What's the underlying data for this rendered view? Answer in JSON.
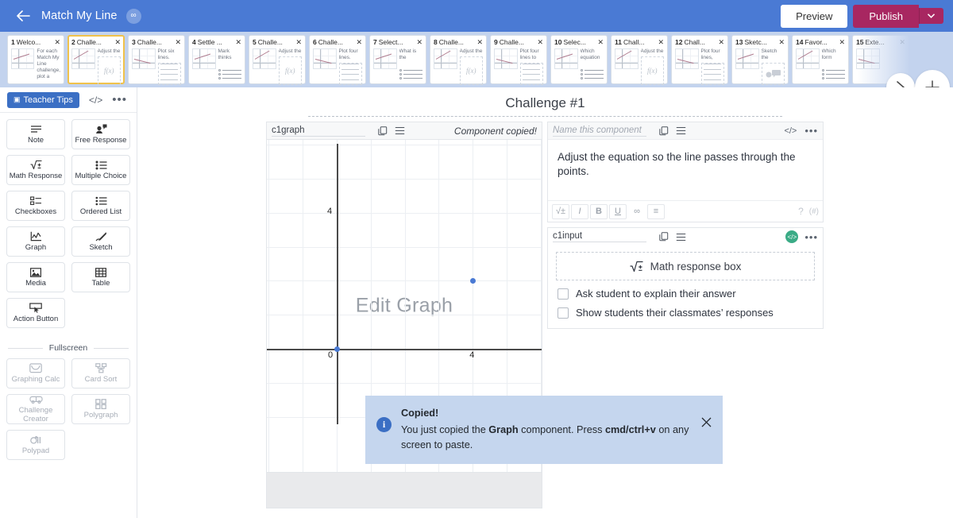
{
  "header": {
    "back_icon": "arrow-left-icon",
    "title": "Match My Line",
    "badge": "∞",
    "preview_label": "Preview",
    "publish_label": "Publish",
    "caret_icon": "chevron-down-icon",
    "bg_color": "#4a7ad4",
    "publish_color": "#a82761"
  },
  "slides": {
    "next_icon": "chevron-right-icon",
    "add_icon": "plus-icon",
    "close_icon": "close-icon",
    "selected_index": 1,
    "items": [
      {
        "num": "1",
        "name": "Welco...",
        "text": "For each Match My Line challenge, plot a",
        "widget": "text"
      },
      {
        "num": "2",
        "name": "Challe...",
        "text": "Adjust the",
        "widget": "fx"
      },
      {
        "num": "3",
        "name": "Challe...",
        "text": "Plot six lines.",
        "widget": "table"
      },
      {
        "num": "4",
        "name": "Settle ...",
        "text": "Mark thinks",
        "widget": "list"
      },
      {
        "num": "5",
        "name": "Challe...",
        "text": "Adjust the",
        "widget": "fx"
      },
      {
        "num": "6",
        "name": "Challe...",
        "text": "Plot four lines.",
        "widget": "table"
      },
      {
        "num": "7",
        "name": "Select...",
        "text": "What is the",
        "widget": "list"
      },
      {
        "num": "8",
        "name": "Challe...",
        "text": "Adjust the",
        "widget": "fx"
      },
      {
        "num": "9",
        "name": "Challe...",
        "text": "Plot four lines to",
        "widget": "table"
      },
      {
        "num": "10",
        "name": "Selec...",
        "text": "Which equation",
        "widget": "list"
      },
      {
        "num": "11",
        "name": "Chall...",
        "text": "Adjust the",
        "widget": "fx"
      },
      {
        "num": "12",
        "name": "Chall...",
        "text": "Plot four lines,",
        "widget": "table"
      },
      {
        "num": "13",
        "name": "Sketc...",
        "text": "Sketch the",
        "widget": "chat"
      },
      {
        "num": "14",
        "name": "Favor...",
        "text": "Which form",
        "widget": "list"
      },
      {
        "num": "15",
        "name": "Exte...",
        "text": "",
        "widget": "none"
      }
    ]
  },
  "sidebar": {
    "teacher_tips_label": "Teacher Tips",
    "teacher_tips_icon": "note-icon",
    "code_icon": "code-icon",
    "more_icon": "more-horizontal-icon",
    "components": [
      {
        "label": "Note",
        "icon": "note-lines-icon"
      },
      {
        "label": "Free Response",
        "icon": "free-response-icon"
      },
      {
        "label": "Math Response",
        "icon": "math-radical-icon"
      },
      {
        "label": "Multiple Choice",
        "icon": "multiple-choice-icon"
      },
      {
        "label": "Checkboxes",
        "icon": "checkboxes-icon"
      },
      {
        "label": "Ordered List",
        "icon": "ordered-list-icon"
      },
      {
        "label": "Graph",
        "icon": "graph-icon"
      },
      {
        "label": "Sketch",
        "icon": "sketch-pencil-icon"
      },
      {
        "label": "Media",
        "icon": "media-image-icon"
      },
      {
        "label": "Table",
        "icon": "table-grid-icon"
      },
      {
        "label": "Action Button",
        "icon": "action-button-icon"
      }
    ],
    "fullscreen_divider": "Fullscreen",
    "fullscreen": [
      {
        "label": "Graphing Calc",
        "icon": "graphing-calc-icon"
      },
      {
        "label": "Card Sort",
        "icon": "card-sort-icon"
      },
      {
        "label": "Challenge Creator",
        "icon": "challenge-creator-icon"
      },
      {
        "label": "Polygraph",
        "icon": "polygraph-icon"
      },
      {
        "label": "Polypad",
        "icon": "polypad-icon"
      }
    ]
  },
  "canvas": {
    "title": "Challenge #1",
    "graph_component": {
      "name": "c1graph",
      "copy_icon": "copy-icon",
      "menu_icon": "menu-icon",
      "status": "Component copied!",
      "placeholder_text": "Edit Graph"
    },
    "text_component": {
      "name_placeholder": "Name this component",
      "copy_icon": "copy-icon",
      "menu_icon": "menu-icon",
      "code_icon": "code-icon",
      "more_icon": "more-horizontal-icon",
      "body": "Adjust the equation so the line passes through the points.",
      "toolbar": [
        {
          "icon": "math-radical-icon",
          "label": "√±"
        },
        {
          "icon": "italic-icon",
          "label": "I"
        },
        {
          "icon": "bold-icon",
          "label": "B"
        },
        {
          "icon": "underline-icon",
          "label": "U"
        },
        {
          "icon": "link-icon",
          "label": "∞"
        },
        {
          "icon": "align-left-icon",
          "label": "≡"
        }
      ],
      "help_icon": "help-circle-icon",
      "extra_icon": "superscript-icon"
    },
    "input_component": {
      "name": "c1input",
      "copy_icon": "copy-icon",
      "menu_icon": "menu-icon",
      "code_badge_icon": "code-icon",
      "badge_color": "#3aab86",
      "more_icon": "more-horizontal-icon",
      "math_box_label": "Math response box",
      "math_box_icon": "math-radical-icon",
      "checkboxes": [
        {
          "label": "Ask student to explain their answer",
          "checked": false
        },
        {
          "label": "Show students their classmates’ responses",
          "checked": false
        }
      ]
    }
  },
  "chart_data": {
    "type": "scatter",
    "title": "",
    "xlabel": "",
    "ylabel": "",
    "xlim": [
      -2,
      6
    ],
    "ylim": [
      -2,
      6
    ],
    "xticks": [
      "0",
      "4"
    ],
    "yticks": [
      "0",
      "4"
    ],
    "grid": true,
    "points": [
      {
        "x": 0,
        "y": 0,
        "color": "#4a7ad4"
      },
      {
        "x": 4,
        "y": 2,
        "color": "#4a7ad4"
      }
    ],
    "series": [
      {
        "name": "points",
        "x": [
          0,
          4
        ],
        "y": [
          0,
          2
        ]
      }
    ]
  },
  "toast": {
    "icon": "info-icon",
    "title": "Copied!",
    "body_pre": "You just copied the ",
    "body_bold1": "Graph",
    "body_mid": " component. Press ",
    "body_bold2": "cmd/ctrl+v",
    "body_post": " on any screen to paste.",
    "close_icon": "close-icon"
  }
}
